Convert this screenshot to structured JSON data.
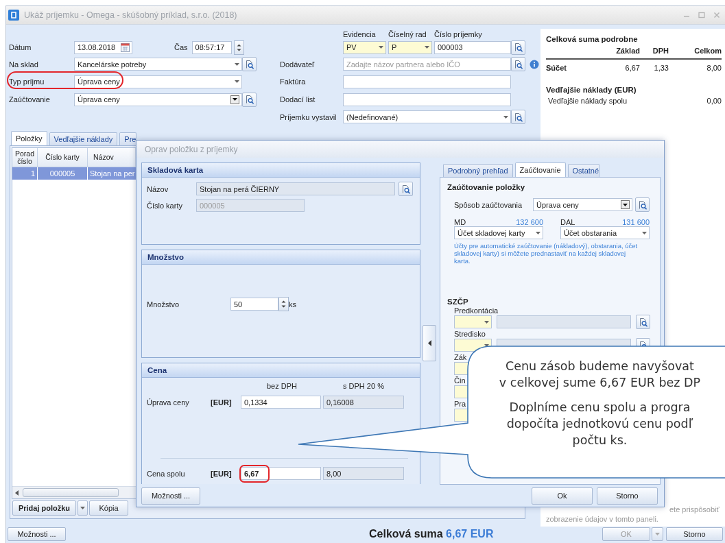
{
  "window": {
    "title": "Ukáž príjemku - Omega - skúšobný príklad, s.r.o. (2018)"
  },
  "header_form": {
    "date": {
      "label": "Dátum",
      "value": "13.08.2018"
    },
    "time": {
      "label": "Čas",
      "value": "08:57:17"
    },
    "warehouse": {
      "label": "Na sklad",
      "value": "Kancelárske potreby"
    },
    "receipt_type": {
      "label": "Typ príjmu",
      "value": "Úprava ceny",
      "highlighted": true
    },
    "posting": {
      "label": "Zaúčtovanie",
      "value": "Úprava ceny"
    },
    "evidence": {
      "label": "Evidencia",
      "value": "PV"
    },
    "series": {
      "label": "Číselný rad",
      "value": "P"
    },
    "number": {
      "label": "Číslo príjemky",
      "value": "000003"
    },
    "supplier": {
      "label": "Dodávateľ",
      "placeholder": "Zadajte názov partnera alebo IČO"
    },
    "invoice": {
      "label": "Faktúra"
    },
    "delivery_note": {
      "label": "Dodací list"
    },
    "issued_by": {
      "label": "Príjemku vystavil",
      "value": "(Nedefinované)"
    }
  },
  "summary": {
    "title": "Celková suma podrobne",
    "columns": [
      "Základ",
      "DPH",
      "Celkom"
    ],
    "total_row": {
      "label": "Súčet",
      "values": [
        "6,67",
        "1,33",
        "8,00"
      ]
    },
    "extra_title": "Vedľajšie náklady (EUR)",
    "extra_row": {
      "label": "Vedľajšie náklady spolu",
      "value": "0,00"
    },
    "note_lines": [
      "ete prispôsobiť",
      "zobrazenie údajov v tomto paneli."
    ]
  },
  "tabs": [
    {
      "label": "Položky",
      "selected": true
    },
    {
      "label": "Vedľajšie náklady",
      "selected": false
    },
    {
      "label": "Pre",
      "selected": false
    }
  ],
  "items_table": {
    "columns": [
      "Porad číslo",
      "Číslo karty",
      "Názov"
    ],
    "rows": [
      {
        "cells": [
          "1",
          "000005",
          "Stojan na per"
        ],
        "selected": true
      }
    ]
  },
  "item_buttons": [
    "Pridaj položku",
    "Kópia"
  ],
  "footer": {
    "options_button": "Možnosti ...",
    "total_label": "Celková suma",
    "total_value": "6,67 EUR",
    "ok": {
      "label": "OK",
      "disabled": true
    },
    "cancel": "Storno"
  },
  "dialog": {
    "title": "Oprav položku z príjemky",
    "sections": [
      {
        "kind": "card",
        "title": "Skladová karta",
        "fields": [
          {
            "label": "Názov",
            "value": "Stojan na perá ČIERNY"
          },
          {
            "label": "Číslo karty",
            "value": "000005"
          }
        ]
      },
      {
        "kind": "quantity",
        "title": "Množstvo",
        "label": "Množstvo",
        "value": "50",
        "unit": "ks"
      },
      {
        "kind": "price",
        "title": "Cena",
        "columns": [
          "bez DPH",
          "s DPH 20 %"
        ],
        "rows": [
          {
            "label": "Úprava ceny",
            "currency": "[EUR]",
            "net": "0,1334",
            "gross": "0,16008",
            "highlighted": false
          },
          {
            "label": "Cena spolu",
            "currency": "[EUR]",
            "net": "6,67",
            "gross": "8,00",
            "highlighted": true
          }
        ]
      }
    ],
    "options_button": "Možnosti ...",
    "tabs": [
      {
        "label": "Podrobný prehľad",
        "selected": false
      },
      {
        "label": "Zaúčtovanie",
        "selected": true
      },
      {
        "label": "Ostatné",
        "selected": false
      }
    ],
    "posting": {
      "title": "Zaúčtovanie položky",
      "method": {
        "label": "Spôsob zaúčtovania",
        "value": "Úprava ceny"
      },
      "debit": {
        "label": "MD",
        "account": "132 600",
        "value": "Účet skladovej karty"
      },
      "credit": {
        "label": "DAL",
        "account": "131 600",
        "value": "Účet obstarania"
      },
      "hint": "Účty pre automatické zaúčtovanie (nákladový), obstarania, účet skladovej karty) si môžete prednastaviť na každej skladovej karta."
    },
    "szcp": {
      "title": "SZČP",
      "fields": [
        {
          "label": "Predkontácia"
        },
        {
          "label": "Stredisko"
        },
        {
          "label": "Zák"
        },
        {
          "label": "Čin"
        },
        {
          "label": "Pra"
        }
      ]
    },
    "buttons": [
      "Ok",
      "Storno"
    ]
  },
  "callout": {
    "paragraphs": [
      [
        "Cenu zásob budeme navyšovat",
        "v celkovej sume 6,67 EUR bez DP"
      ],
      [
        "Doplníme cenu spolu a progra",
        "dopočíta jednotkovú cenu podľ",
        "počtu ks."
      ]
    ]
  }
}
